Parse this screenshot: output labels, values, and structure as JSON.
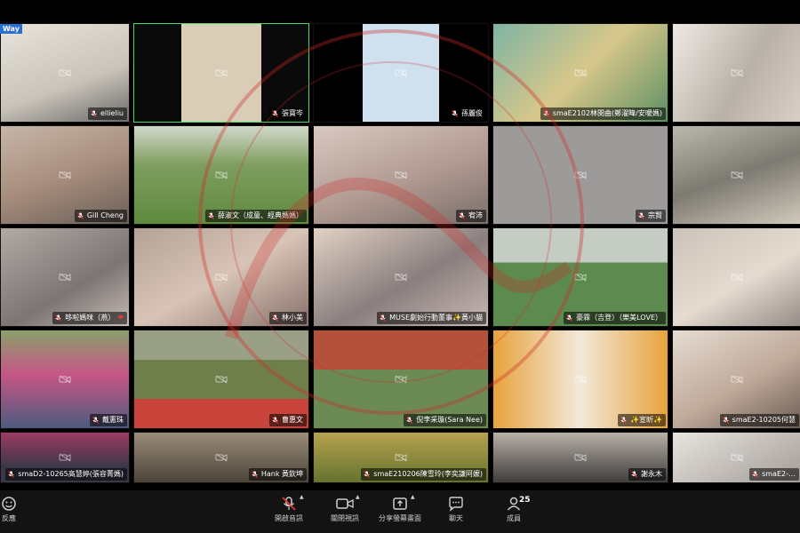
{
  "meeting": {
    "top_badge": "Way",
    "tiles": [
      {
        "name": "ellieliu",
        "bg": "bg-1"
      },
      {
        "name": "張寶岑",
        "bg": "bg-2",
        "active": true
      },
      {
        "name": "孫麗俊",
        "bg": "bg-3"
      },
      {
        "name": "smaE2102林閔曲(鄭濯暐/安暖媽)",
        "bg": "bg-4"
      },
      {
        "name": "",
        "bg": "bg-5"
      },
      {
        "name": "Gill Cheng",
        "bg": "bg-6"
      },
      {
        "name": "薛淑文（成童、經典媽媽）",
        "bg": "bg-7"
      },
      {
        "name": "宥沛",
        "bg": "bg-8"
      },
      {
        "name": "宗賢",
        "bg": "bg-9"
      },
      {
        "name": "",
        "bg": "bg-10"
      },
      {
        "name": "哆啦媽咪（燕）",
        "bg": "bg-11",
        "heart": "❤"
      },
      {
        "name": "林小美",
        "bg": "bg-12"
      },
      {
        "name": "MUSE劇始行動董事✨黃小貓",
        "bg": "bg-13"
      },
      {
        "name": "豪霖（吉登）（樂美LOVE）",
        "bg": "bg-14"
      },
      {
        "name": "",
        "bg": "bg-15"
      },
      {
        "name": "戴憲珠",
        "bg": "bg-16"
      },
      {
        "name": "曹惠文",
        "bg": "bg-17"
      },
      {
        "name": "倪李采璇(Sara Nee)",
        "bg": "bg-18"
      },
      {
        "name": "✨宣昕✨",
        "bg": "bg-19"
      },
      {
        "name": "smaE2-10205何慧",
        "bg": "bg-20"
      },
      {
        "name": "smaD2-10265高慧婷(張容菁媽)",
        "bg": "bg-21"
      },
      {
        "name": "Hank 黃欽坤",
        "bg": "bg-22"
      },
      {
        "name": "smaE210206陳雪玲(李奕謙阿嬤)",
        "bg": "bg-23"
      },
      {
        "name": "謝永木",
        "bg": "bg-24"
      },
      {
        "name": "smaE2-…",
        "bg": "bg-25"
      }
    ]
  },
  "toolbar": {
    "reactions_label": "反應",
    "mute_label": "開啟音訊",
    "video_label": "關閉視訊",
    "share_label": "分享螢幕畫面",
    "chat_label": "聊天",
    "participants_label": "成員",
    "participants_count": "25"
  },
  "colors": {
    "active_speaker": "#4cd964",
    "muted_mic": "#e53935",
    "toolbar_bg": "#131313"
  },
  "icons": {
    "reaction": "smiley-icon",
    "mic": "microphone-muted-icon",
    "video": "video-camera-icon",
    "share": "share-screen-icon",
    "chat": "chat-bubble-icon",
    "participants": "participants-icon"
  }
}
